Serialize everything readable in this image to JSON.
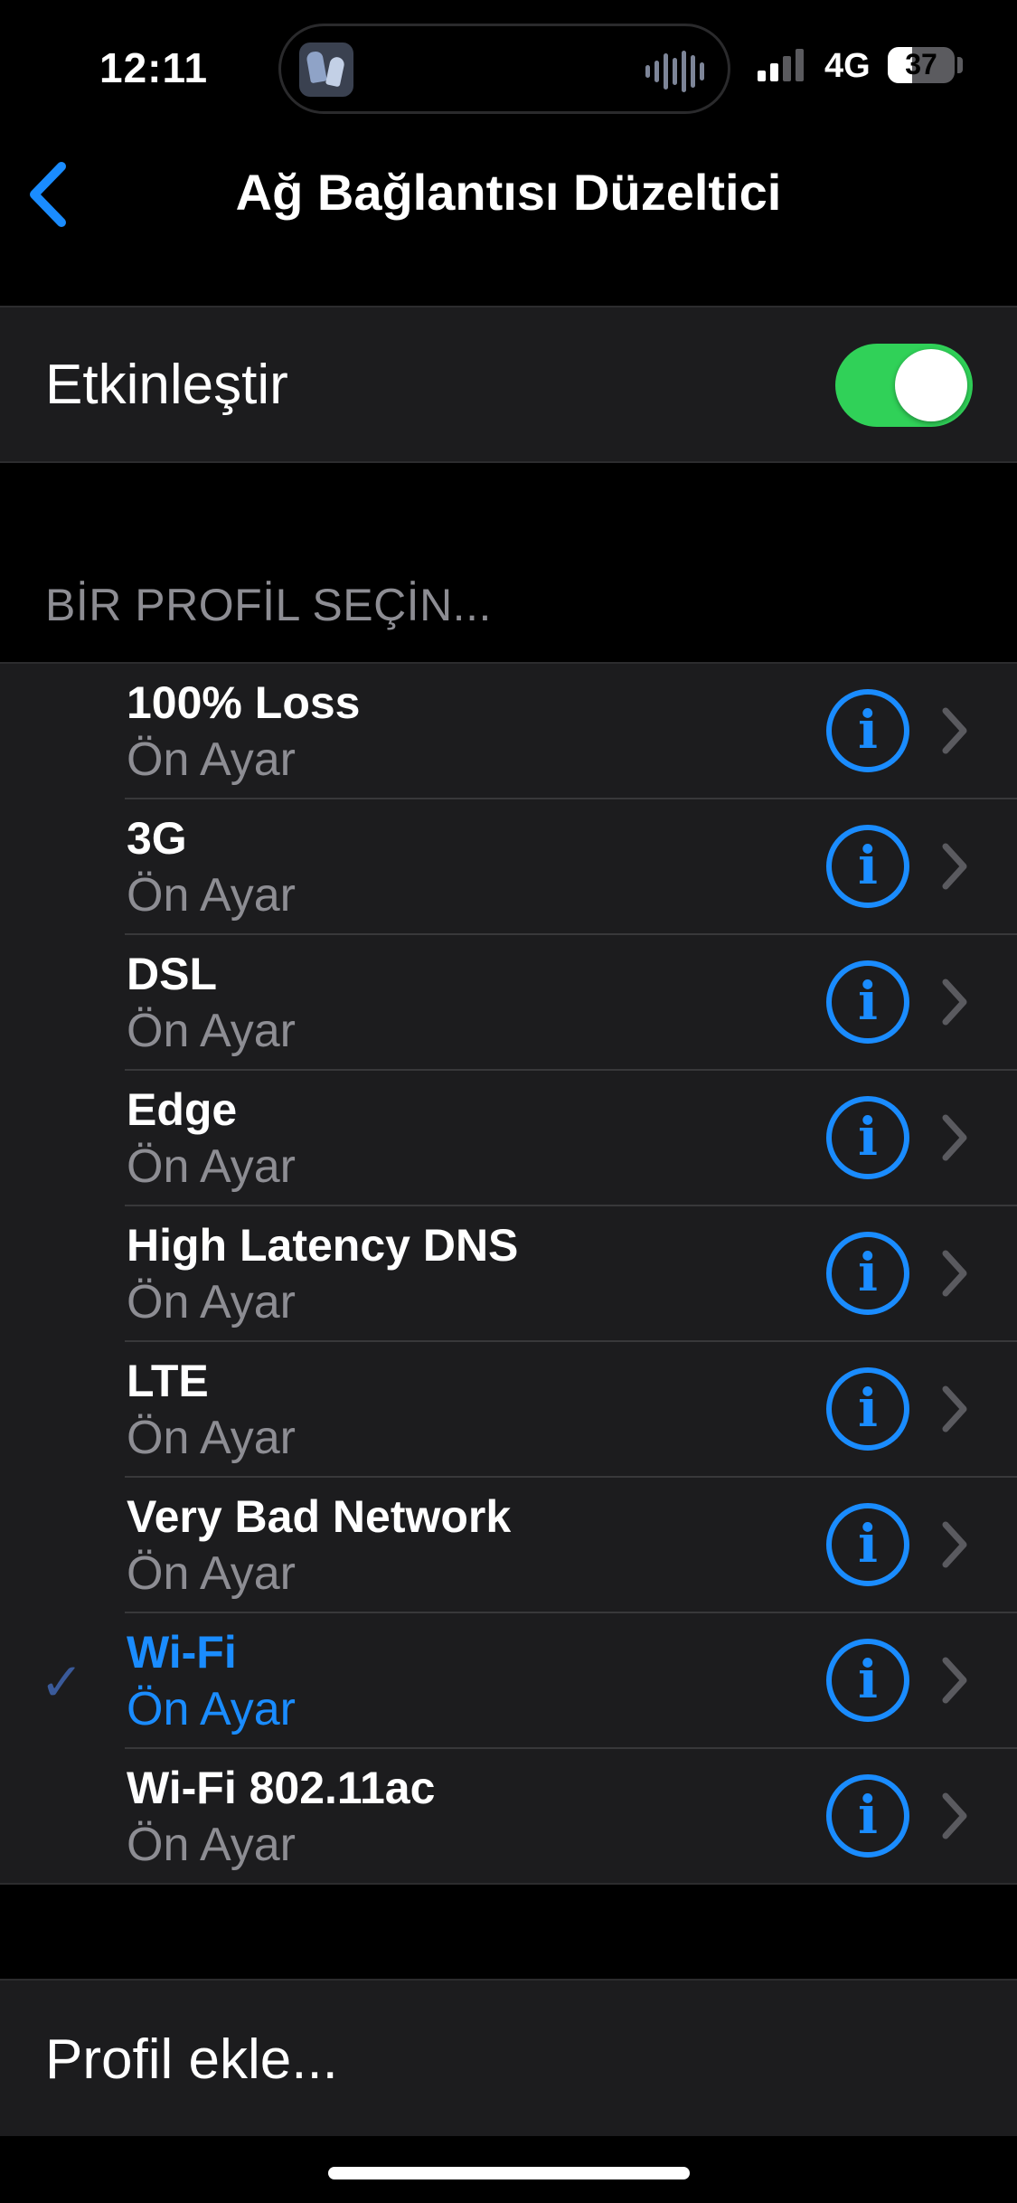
{
  "status_bar": {
    "time": "12:11",
    "network": "4G",
    "battery": "37",
    "battery_level": 0.37,
    "signal_bars_active": 2,
    "signal_bars_total": 4
  },
  "nav": {
    "title": "Ağ Bağlantısı Düzeltici",
    "back_icon": "chevron-left-icon"
  },
  "enable": {
    "label": "Etkinleştir",
    "on": true
  },
  "profiles_header": "BİR PROFİL SEÇİN...",
  "profiles": [
    {
      "name": "100% Loss",
      "sub": "Ön Ayar",
      "selected": false
    },
    {
      "name": "3G",
      "sub": "Ön Ayar",
      "selected": false
    },
    {
      "name": "DSL",
      "sub": "Ön Ayar",
      "selected": false
    },
    {
      "name": "Edge",
      "sub": "Ön Ayar",
      "selected": false
    },
    {
      "name": "High Latency DNS",
      "sub": "Ön Ayar",
      "selected": false
    },
    {
      "name": "LTE",
      "sub": "Ön Ayar",
      "selected": false
    },
    {
      "name": "Very Bad Network",
      "sub": "Ön Ayar",
      "selected": false
    },
    {
      "name": "Wi-Fi",
      "sub": "Ön Ayar",
      "selected": true
    },
    {
      "name": "Wi-Fi 802.11ac",
      "sub": "Ön Ayar",
      "selected": false
    }
  ],
  "add_profile": {
    "label": "Profil ekle..."
  },
  "icons": {
    "info": "i",
    "checkmark": "✓"
  },
  "colors": {
    "accent": "#1a8cff",
    "toggle_on": "#30d158",
    "background": "#000000",
    "cell": "#1c1c1e",
    "secondary_text": "#8d8d93"
  }
}
